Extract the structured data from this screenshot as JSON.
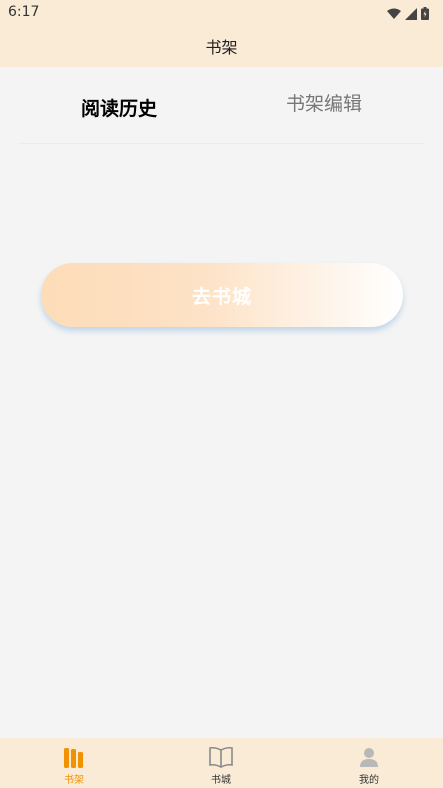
{
  "status_bar": {
    "time": "6:17",
    "icons": [
      "wifi-icon",
      "signal-icon",
      "battery-icon"
    ]
  },
  "header": {
    "title": "书架"
  },
  "tabs": [
    {
      "label": "阅读历史",
      "active": true
    },
    {
      "label": "书架编辑",
      "active": false
    }
  ],
  "cta": {
    "label": "去书城"
  },
  "bottom_nav": [
    {
      "label": "书架",
      "icon": "bookshelf-icon",
      "active": true
    },
    {
      "label": "书城",
      "icon": "book-open-icon",
      "active": false
    },
    {
      "label": "我的",
      "icon": "person-icon",
      "active": false
    }
  ],
  "colors": {
    "header_bg": "#faebd6",
    "accent": "#f39200",
    "inactive_icon": "#8a8a8a",
    "page_bg": "#f4f4f4"
  }
}
